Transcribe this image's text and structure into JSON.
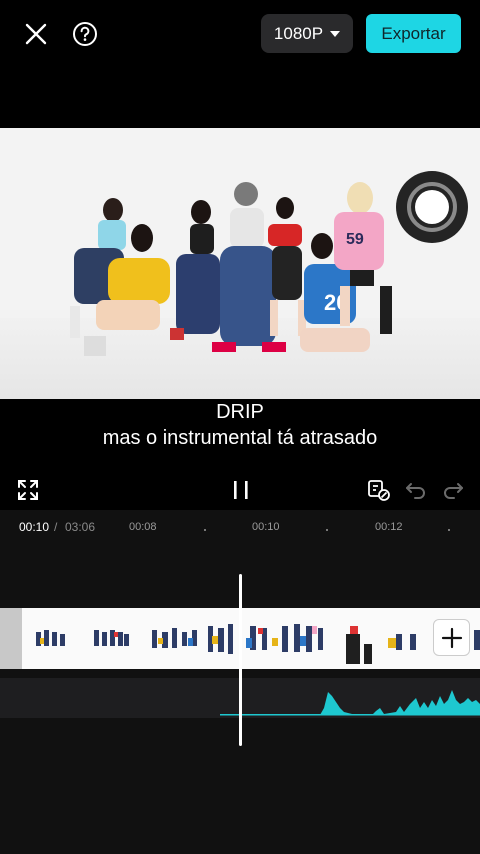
{
  "header": {
    "resolution_label": "1080P",
    "export_label": "Exportar"
  },
  "captions": {
    "line1": "DRIP",
    "line2": "mas o instrumental tá atrasado"
  },
  "timeline": {
    "current_time": "00:10",
    "separator": "/",
    "total_time": "03:06",
    "markers": [
      "00:08",
      "00:10",
      "00:12"
    ]
  },
  "colors": {
    "accent": "#1ed6e4",
    "waveform": "#1ec8d0"
  }
}
